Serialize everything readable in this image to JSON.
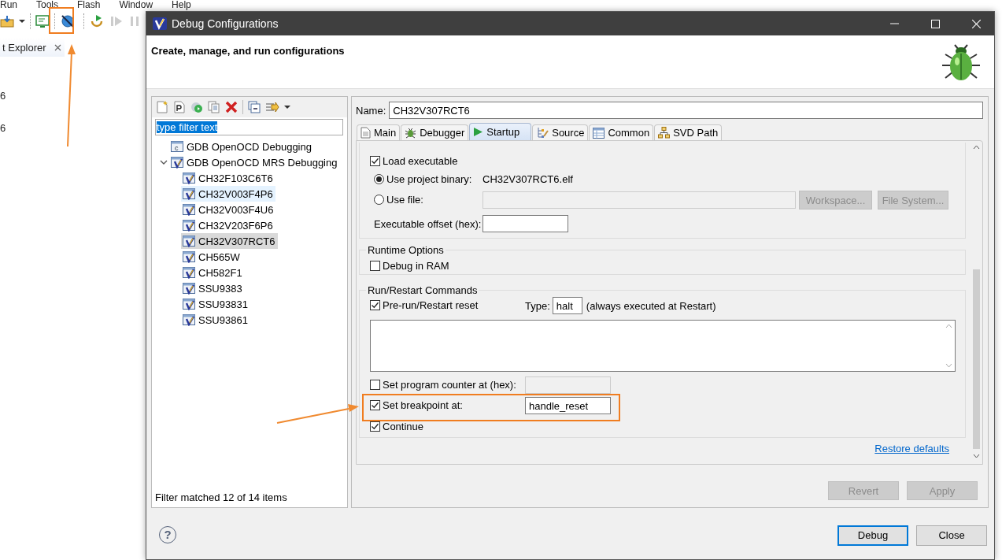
{
  "ide": {
    "menu": [
      "Run",
      "Tools",
      "Flash",
      "Window",
      "Help"
    ],
    "view_tab": {
      "label": "t Explorer"
    },
    "fragments": [
      "6",
      "6"
    ]
  },
  "dialog": {
    "title": "Debug Configurations",
    "header": "Create, manage, and run configurations",
    "filter": {
      "value": "type filter text",
      "text_selected": true
    },
    "tree": [
      {
        "label": "GDB OpenOCD Debugging",
        "kind": "c",
        "selected": false,
        "hovered": false
      },
      {
        "label": "GDB OpenOCD MRS Debugging",
        "kind": "mrs",
        "selected": false,
        "hovered": false,
        "expanded": true,
        "children": [
          {
            "label": "CH32F103C6T6",
            "kind": "mrs",
            "selected": false,
            "hovered": false
          },
          {
            "label": "CH32V003F4P6",
            "kind": "mrs",
            "selected": false,
            "hovered": true
          },
          {
            "label": "CH32V003F4U6",
            "kind": "mrs",
            "selected": false,
            "hovered": false
          },
          {
            "label": "CH32V203F6P6",
            "kind": "mrs",
            "selected": false,
            "hovered": false
          },
          {
            "label": "CH32V307RCT6",
            "kind": "mrs",
            "selected": true,
            "hovered": false
          },
          {
            "label": "CH565W",
            "kind": "mrs",
            "selected": false,
            "hovered": false
          },
          {
            "label": "CH582F1",
            "kind": "mrs",
            "selected": false,
            "hovered": false
          },
          {
            "label": "SSU9383",
            "kind": "mrs",
            "selected": false,
            "hovered": false
          },
          {
            "label": "SSU93831",
            "kind": "mrs",
            "selected": false,
            "hovered": false
          },
          {
            "label": "SSU93861",
            "kind": "mrs",
            "selected": false,
            "hovered": false
          }
        ]
      }
    ],
    "filter_status": "Filter matched 12 of 14 items",
    "name": {
      "label": "Name:",
      "value": "CH32V307RCT6"
    },
    "tabs": [
      {
        "label": "Main",
        "kind": "main",
        "selected": false
      },
      {
        "label": "Debugger",
        "kind": "debugger",
        "selected": false
      },
      {
        "label": "Startup",
        "kind": "startup",
        "selected": true
      },
      {
        "label": "Source",
        "kind": "source",
        "selected": false
      },
      {
        "label": "Common",
        "kind": "common",
        "selected": false
      },
      {
        "label": "SVD Path",
        "kind": "svd",
        "selected": false
      }
    ],
    "startup": {
      "load_executable": {
        "label": "Load executable",
        "checked": true
      },
      "binary_options": [
        {
          "label": "Use project binary:",
          "selected": true,
          "value": "CH32V307RCT6.elf"
        },
        {
          "label": "Use file:",
          "selected": false
        }
      ],
      "file_buttons": [
        {
          "label": "Workspace...",
          "disabled": true
        },
        {
          "label": "File System...",
          "disabled": true
        }
      ],
      "executable_offset": {
        "label": "Executable offset (hex):"
      },
      "runtime": {
        "title": "Runtime Options",
        "debug_in_ram": {
          "label": "Debug in RAM",
          "checked": false
        }
      },
      "run_restart": {
        "title": "Run/Restart Commands",
        "pre_run": {
          "label": "Pre-run/Restart reset",
          "checked": true
        },
        "type": {
          "label": "Type:",
          "value": "halt",
          "note": "(always executed at Restart)"
        },
        "program_counter": {
          "label": "Set program counter at (hex):",
          "checked": false,
          "disabled": true
        },
        "breakpoint": {
          "label": "Set breakpoint at:",
          "checked": true,
          "value": "handle_reset"
        },
        "continue": {
          "label": "Continue",
          "checked": true
        }
      }
    },
    "restore_defaults": "Restore defaults",
    "panel_buttons": [
      {
        "label": "Revert",
        "disabled": true
      },
      {
        "label": "Apply",
        "disabled": true
      }
    ],
    "help": "?",
    "buttons": [
      {
        "label": "Debug",
        "default": true
      },
      {
        "label": "Close",
        "default": false
      }
    ]
  }
}
